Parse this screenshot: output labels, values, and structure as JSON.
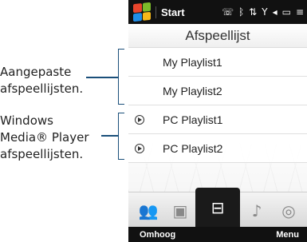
{
  "annotations": {
    "custom_lines": [
      "Aangepaste",
      "afspeellijsten."
    ],
    "wmp_lines": [
      "Windows",
      "Media® Player",
      "afspeellijsten."
    ]
  },
  "statusbar": {
    "start_label": "Start",
    "icons": [
      "phone-signal-icon",
      "bluetooth-icon",
      "data-icon",
      "signal-icon",
      "volume-icon",
      "battery-icon",
      "close-icon"
    ]
  },
  "title": "Afspeellijst",
  "playlists": [
    {
      "label": "My Playlist1",
      "type": "custom"
    },
    {
      "label": "My Playlist2",
      "type": "custom"
    },
    {
      "label": "PC Playlist1",
      "type": "pc"
    },
    {
      "label": "PC Playlist2",
      "type": "pc"
    }
  ],
  "tabs": [
    {
      "name": "contacts-tab",
      "icon": "people-icon",
      "glyph": "👥"
    },
    {
      "name": "photos-tab",
      "icon": "photo-icon",
      "glyph": "▣"
    },
    {
      "name": "video-tab",
      "icon": "video-icon",
      "glyph": "⊟"
    },
    {
      "name": "music-tab",
      "icon": "music-note-icon",
      "glyph": "♪"
    },
    {
      "name": "settings-tab",
      "icon": "settings-icon",
      "glyph": "◎"
    }
  ],
  "softkeys": {
    "left": "Omhoog",
    "right": "Menu"
  },
  "colors": {
    "bracket": "#1a4f7a",
    "bar": "#111111"
  }
}
